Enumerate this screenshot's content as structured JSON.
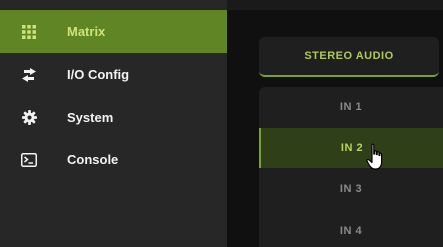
{
  "sidebar": {
    "items": [
      {
        "label": "Matrix",
        "icon": "grid-icon",
        "active": true
      },
      {
        "label": "I/O Config",
        "icon": "swap-arrows-icon",
        "active": false
      },
      {
        "label": "System",
        "icon": "gear-icon",
        "active": false
      },
      {
        "label": "Console",
        "icon": "terminal-icon",
        "active": false
      }
    ]
  },
  "main": {
    "header_tab": "STEREO AUDIO",
    "inputs": [
      {
        "label": "IN 1"
      },
      {
        "label": "IN 2",
        "selected": true
      },
      {
        "label": "IN 3"
      },
      {
        "label": "IN 4"
      }
    ]
  },
  "colors": {
    "sidebar_bg": "#272727",
    "active_bg": "#5f8525",
    "accent": "#7aa32c",
    "accent_text": "#b8d35e",
    "main_bg": "#101010",
    "panel_bg": "#1f1f1f"
  }
}
